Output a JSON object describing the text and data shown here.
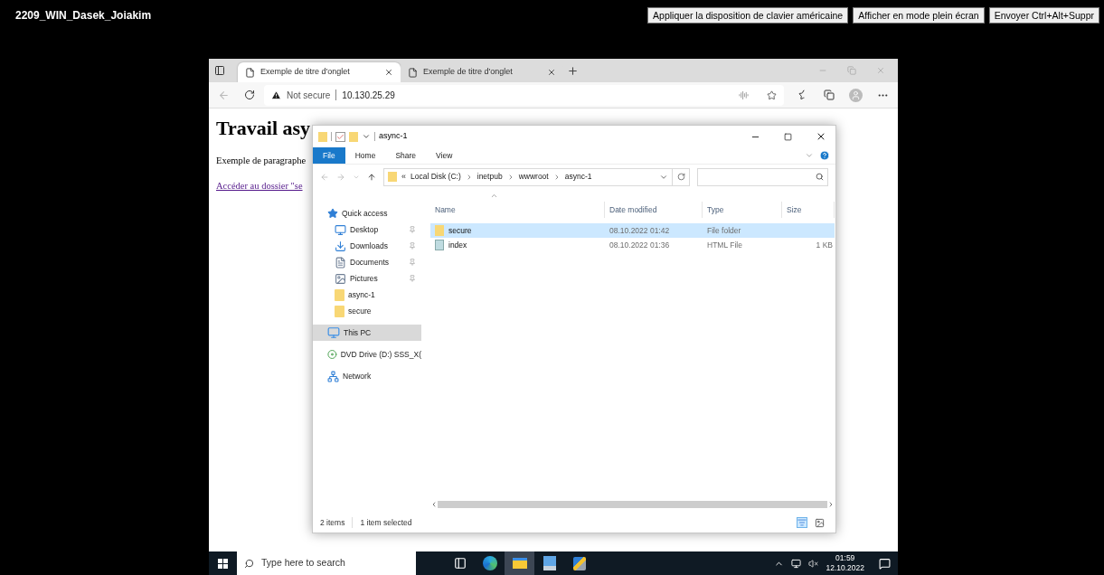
{
  "viewer": {
    "title": "2209_WIN_Dasek_Joiakim",
    "buttons": [
      "Appliquer la disposition de clavier américaine",
      "Afficher en mode plein écran",
      "Envoyer Ctrl+Alt+Suppr"
    ]
  },
  "browser": {
    "tabs": [
      {
        "label": "Exemple de titre d'onglet",
        "selected": true
      },
      {
        "label": "Exemple de titre d'onglet",
        "selected": false
      }
    ],
    "security": "Not secure",
    "url": "10.130.25.29",
    "page": {
      "heading": "Travail asy",
      "paragraph": "Exemple de paragraphe",
      "link": "Accéder au dossier \"se"
    }
  },
  "explorer": {
    "title": "async-1",
    "ribbon_tabs": [
      {
        "label": "File",
        "selected": true
      },
      {
        "label": "Home",
        "selected": false
      },
      {
        "label": "Share",
        "selected": false
      },
      {
        "label": "View",
        "selected": false
      }
    ],
    "breadcrumb_overflow": "«",
    "breadcrumb": [
      "Local Disk (C:)",
      "inetpub",
      "wwwroot",
      "async-1"
    ],
    "nav": [
      {
        "label": "Quick access",
        "kind": "star",
        "pinned": false,
        "selected": false
      },
      {
        "label": "Desktop",
        "kind": "desktop",
        "pinned": true,
        "selected": false
      },
      {
        "label": "Downloads",
        "kind": "downloads",
        "pinned": true,
        "selected": false
      },
      {
        "label": "Documents",
        "kind": "documents",
        "pinned": true,
        "selected": false
      },
      {
        "label": "Pictures",
        "kind": "pictures",
        "pinned": true,
        "selected": false
      },
      {
        "label": "async-1",
        "kind": "folder",
        "pinned": false,
        "selected": false
      },
      {
        "label": "secure",
        "kind": "folder",
        "pinned": false,
        "selected": false
      },
      {
        "label": "This PC",
        "kind": "pc",
        "pinned": false,
        "selected": true
      },
      {
        "label": "DVD Drive (D:) SSS_X(",
        "kind": "dvd",
        "pinned": false,
        "selected": false
      },
      {
        "label": "Network",
        "kind": "network",
        "pinned": false,
        "selected": false
      }
    ],
    "columns": [
      "Name",
      "Date modified",
      "Type",
      "Size"
    ],
    "rows": [
      {
        "name": "secure",
        "date": "08.10.2022 01:42",
        "type": "File folder",
        "size": "",
        "kind": "folder",
        "selected": true
      },
      {
        "name": "index",
        "date": "08.10.2022 01:36",
        "type": "HTML File",
        "size": "1 KB",
        "kind": "html",
        "selected": false
      }
    ],
    "status": [
      "2 items",
      "1 item selected"
    ]
  },
  "taskbar": {
    "search_placeholder": "Type here to search",
    "apps": [
      {
        "kind": "taskview",
        "active": false
      },
      {
        "kind": "edge",
        "active": false
      },
      {
        "kind": "explorer",
        "active": true
      },
      {
        "kind": "server",
        "active": false
      },
      {
        "kind": "setup",
        "active": false
      }
    ],
    "time": "01:59",
    "date": "12.10.2022"
  }
}
